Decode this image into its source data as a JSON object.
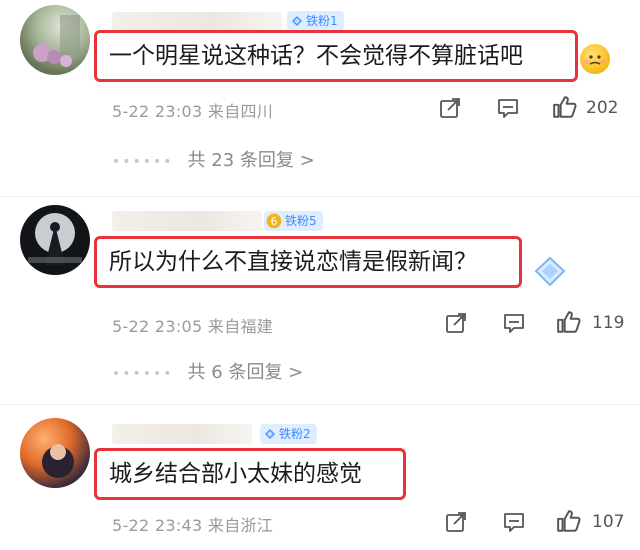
{
  "comments": [
    {
      "fan_badge": "铁粉1",
      "text": "一个明星说这种话？不会觉得不算脏话吧",
      "date": "5-22",
      "time": "23:03",
      "location": "来自四川",
      "likes": "202",
      "replies_label": "共 23 条回复 >"
    },
    {
      "fan_badge": "铁粉5",
      "text": "所以为什么不直接说恋情是假新闻？",
      "date": "5-22",
      "time": "23:05",
      "location": "来自福建",
      "likes": "119",
      "replies_label": "共 6 条回复 >"
    },
    {
      "fan_badge": "铁粉2",
      "text": "城乡结合部小太妹的感觉",
      "date": "5-22",
      "time": "23:43",
      "location": "来自浙江",
      "likes": "107"
    }
  ],
  "colors": {
    "highlight_border": "#e8333b",
    "badge_bg": "#dfeeff",
    "badge_text": "#3f8cff",
    "meta_text": "#9a9a9a"
  },
  "icons": [
    "share-icon",
    "comment-icon",
    "like-icon",
    "gem-icon",
    "emoji-icon"
  ]
}
